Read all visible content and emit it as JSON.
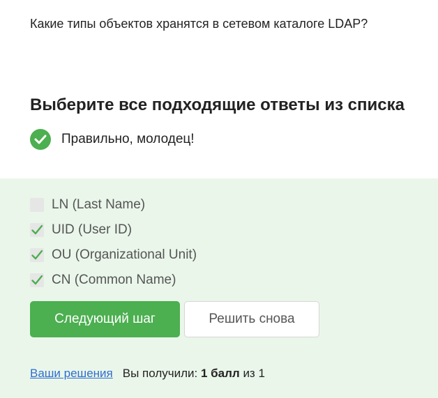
{
  "question": {
    "text": "Какие типы объектов хранятся в сетевом каталоге LDAP?"
  },
  "instruction": "Выберите все подходящие ответы из списка",
  "feedback": {
    "text": "Правильно, молодец!",
    "icon": "check-circle-icon",
    "color": "#4caf50"
  },
  "options": [
    {
      "label": "LN (Last Name)",
      "checked": false
    },
    {
      "label": "UID (User ID)",
      "checked": true
    },
    {
      "label": "OU (Organizational Unit)",
      "checked": true
    },
    {
      "label": "CN (Common Name)",
      "checked": true
    }
  ],
  "buttons": {
    "next": "Следующий шаг",
    "retry": "Решить снова"
  },
  "result": {
    "link": "Ваши решения",
    "prefix": "Вы получили:",
    "score": "1 балл",
    "suffix": "из 1"
  },
  "colors": {
    "accent": "#4caf50",
    "panel_bg": "#eaf6ea",
    "link": "#2f6ecf"
  }
}
